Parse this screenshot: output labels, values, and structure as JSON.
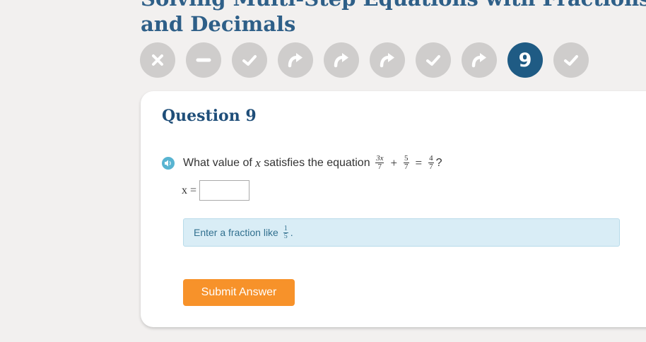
{
  "lesson": {
    "title_line1": "Solving Multi-Step Equations with Fractions",
    "title_line2": "and Decimals"
  },
  "progress": {
    "steps": [
      {
        "status": "incorrect",
        "icon": "x-icon"
      },
      {
        "status": "skipped",
        "icon": "minus-icon"
      },
      {
        "status": "correct",
        "icon": "check-icon"
      },
      {
        "status": "retry",
        "icon": "redo-arrow-icon"
      },
      {
        "status": "retry",
        "icon": "redo-arrow-icon"
      },
      {
        "status": "retry",
        "icon": "redo-arrow-icon"
      },
      {
        "status": "correct",
        "icon": "check-icon"
      },
      {
        "status": "retry",
        "icon": "redo-arrow-icon"
      },
      {
        "status": "current",
        "label": "9"
      },
      {
        "status": "correct",
        "icon": "check-icon"
      }
    ],
    "colors": {
      "inactive": "#cfcdcc",
      "current": "#1f5b84"
    }
  },
  "question": {
    "heading": "Question 9",
    "prompt_text": "What value of",
    "variable": "x",
    "prompt_text2": "satisfies the equation",
    "equation": {
      "term1_num": "3x",
      "term1_den": "7",
      "op1": "+",
      "term2_num": "5",
      "term2_den": "7",
      "op2": "=",
      "rhs_num": "4",
      "rhs_den": "7"
    },
    "end_punct": "?"
  },
  "answer": {
    "label": "x =",
    "value": ""
  },
  "hint": {
    "text": "Enter a fraction like",
    "example_num": "1",
    "example_den": "5",
    "end": "."
  },
  "actions": {
    "submit_label": "Submit Answer",
    "submit_color": "#f7922a"
  }
}
